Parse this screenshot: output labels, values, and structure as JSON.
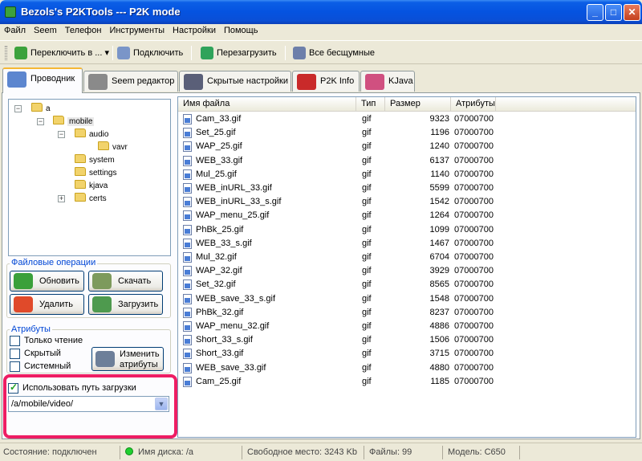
{
  "window": {
    "title": "Bezols's P2KTools --- P2K mode",
    "min": "_",
    "max": "□",
    "close": "✕"
  },
  "menu": [
    "Файл",
    "Seem",
    "Телефон",
    "Инструменты",
    "Настройки",
    "Помощь"
  ],
  "toolbar": {
    "switch": "Переключить в ...",
    "connect": "Подключить",
    "restart": "Перезагрузить",
    "all_ringtones": "Все бесщумные"
  },
  "tabs": [
    "Проводник",
    "Seem редактор",
    "Скрытые настройки",
    "P2K Info",
    "KJava"
  ],
  "tree": {
    "root": "a",
    "mobile": "mobile",
    "audio": "audio",
    "vavr": "vavr",
    "system": "system",
    "settings": "settings",
    "kjava": "kjava",
    "certs": "certs"
  },
  "file_ops": {
    "title": "Файловые операции",
    "refresh": "Обновить",
    "download": "Скачать",
    "delete": "Удалить",
    "upload": "Загрузить"
  },
  "attributes": {
    "title": "Атрибуты",
    "readonly": "Только чтение",
    "hidden": "Скрытый",
    "system": "Системный",
    "change": "Изменить атрибуты"
  },
  "upload_path": {
    "checkbox_label": "Использовать путь загрузки",
    "checked": true,
    "value": "/a/mobile/video/",
    "arrow": "▼"
  },
  "file_list": {
    "headers": [
      "Имя файла",
      "Тип",
      "Размер",
      "Атрибуты"
    ],
    "rows": [
      [
        "Cam_33.gif",
        "gif",
        "9323",
        "07000700"
      ],
      [
        "Set_25.gif",
        "gif",
        "1196",
        "07000700"
      ],
      [
        "WAP_25.gif",
        "gif",
        "1240",
        "07000700"
      ],
      [
        "WEB_33.gif",
        "gif",
        "6137",
        "07000700"
      ],
      [
        "Mul_25.gif",
        "gif",
        "1140",
        "07000700"
      ],
      [
        "WEB_inURL_33.gif",
        "gif",
        "5599",
        "07000700"
      ],
      [
        "WEB_inURL_33_s.gif",
        "gif",
        "1542",
        "07000700"
      ],
      [
        "WAP_menu_25.gif",
        "gif",
        "1264",
        "07000700"
      ],
      [
        "PhBk_25.gif",
        "gif",
        "1099",
        "07000700"
      ],
      [
        "WEB_33_s.gif",
        "gif",
        "1467",
        "07000700"
      ],
      [
        "Mul_32.gif",
        "gif",
        "6704",
        "07000700"
      ],
      [
        "WAP_32.gif",
        "gif",
        "3929",
        "07000700"
      ],
      [
        "Set_32.gif",
        "gif",
        "8565",
        "07000700"
      ],
      [
        "WEB_save_33_s.gif",
        "gif",
        "1548",
        "07000700"
      ],
      [
        "PhBk_32.gif",
        "gif",
        "8237",
        "07000700"
      ],
      [
        "WAP_menu_32.gif",
        "gif",
        "4886",
        "07000700"
      ],
      [
        "Short_33_s.gif",
        "gif",
        "1506",
        "07000700"
      ],
      [
        "Short_33.gif",
        "gif",
        "3715",
        "07000700"
      ],
      [
        "WEB_save_33.gif",
        "gif",
        "4880",
        "07000700"
      ],
      [
        "Cam_25.gif",
        "gif",
        "1185",
        "07000700"
      ]
    ]
  },
  "status": {
    "state": "Состояние: подключен",
    "disk": "Имя диска: /a",
    "free": "Свободное место: 3243 Kb",
    "files": "Файлы: 99",
    "model": "Модель: C650"
  },
  "colors": {
    "titlebar": "#0553e0",
    "highlight": "#ee1d63",
    "link": "#0046d5"
  }
}
